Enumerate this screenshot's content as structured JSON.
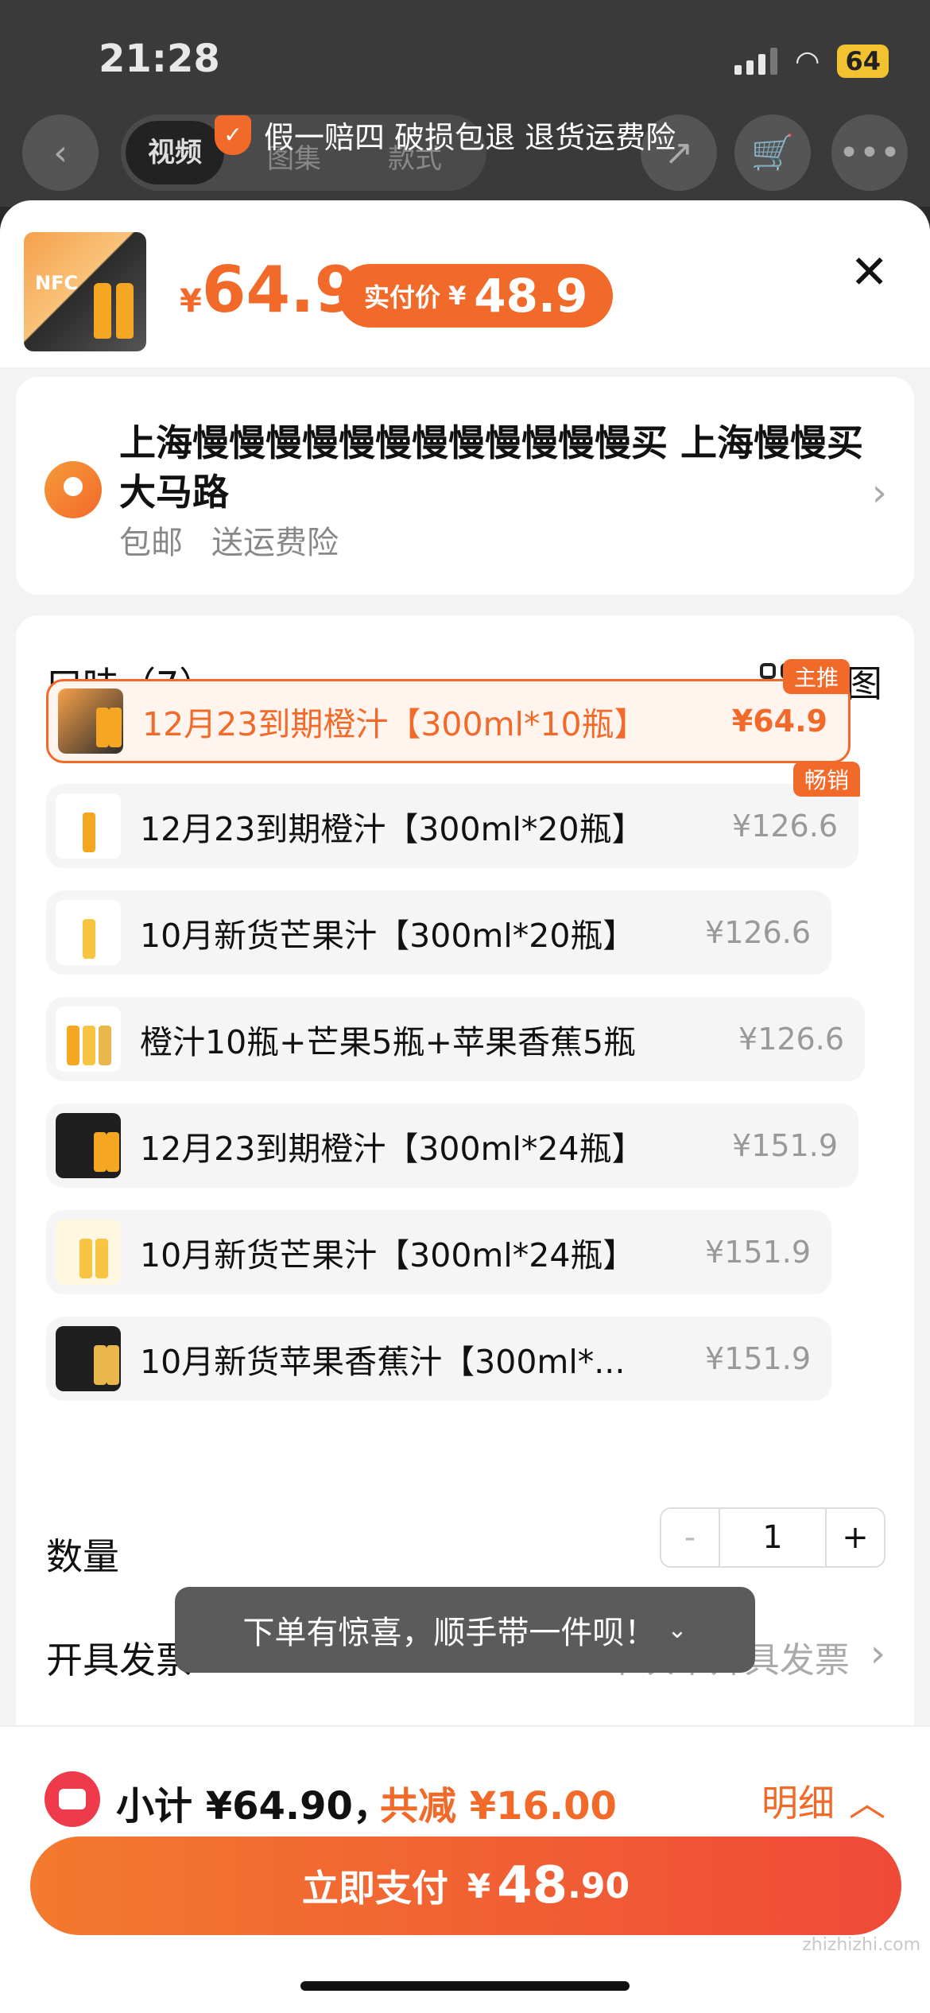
{
  "status": {
    "time": "21:28",
    "battery": "64"
  },
  "nav": {
    "tabs": [
      "视频",
      "图集",
      "款式"
    ]
  },
  "banner": {
    "text": "假一赔四 破损包退 退货运费险"
  },
  "product": {
    "price_yen": "¥",
    "price": "64.9",
    "real_label": "实付价",
    "real_yen": "¥",
    "real_price": "48.9"
  },
  "address": {
    "line": "上海慢慢慢慢慢慢慢慢慢慢慢慢买 上海慢慢买大马路",
    "tags": [
      "包邮",
      "送运费险"
    ]
  },
  "spec": {
    "title": "口味（7）",
    "bigview": "大图",
    "options": [
      {
        "name": "12月23到期橙汁【300ml*10瓶】",
        "price": "¥64.9",
        "tag": "主推"
      },
      {
        "name": "12月23到期橙汁【300ml*20瓶】",
        "price": "¥126.6",
        "tag": "畅销"
      },
      {
        "name": "10月新货芒果汁【300ml*20瓶】",
        "price": "¥126.6"
      },
      {
        "name": "橙汁10瓶+芒果5瓶+苹果香蕉5瓶",
        "price": "¥126.6"
      },
      {
        "name": "12月23到期橙汁【300ml*24瓶】",
        "price": "¥151.9"
      },
      {
        "name": "10月新货芒果汁【300ml*24瓶】",
        "price": "¥151.9"
      },
      {
        "name": "10月新货苹果香蕉汁【300ml*...",
        "price": "¥151.9"
      }
    ]
  },
  "quantity": {
    "label": "数量",
    "minus": "-",
    "value": "1",
    "plus": "+"
  },
  "invoice": {
    "label": "开具发票",
    "value": "本次不开具发票"
  },
  "toast": {
    "text": "下单有惊喜，顺手带一件呗！"
  },
  "footer": {
    "subtotal": "小计 ¥64.90，",
    "discount": "共减 ¥16.00",
    "detail": "明细",
    "pay_label": "立即支付",
    "pay_yen": "¥",
    "pay_int": "48",
    "pay_dec": ".90"
  },
  "watermark": "zhizhizhi.com",
  "colors": {
    "accent": "#f26a2a",
    "danger": "#ee3a4a"
  }
}
